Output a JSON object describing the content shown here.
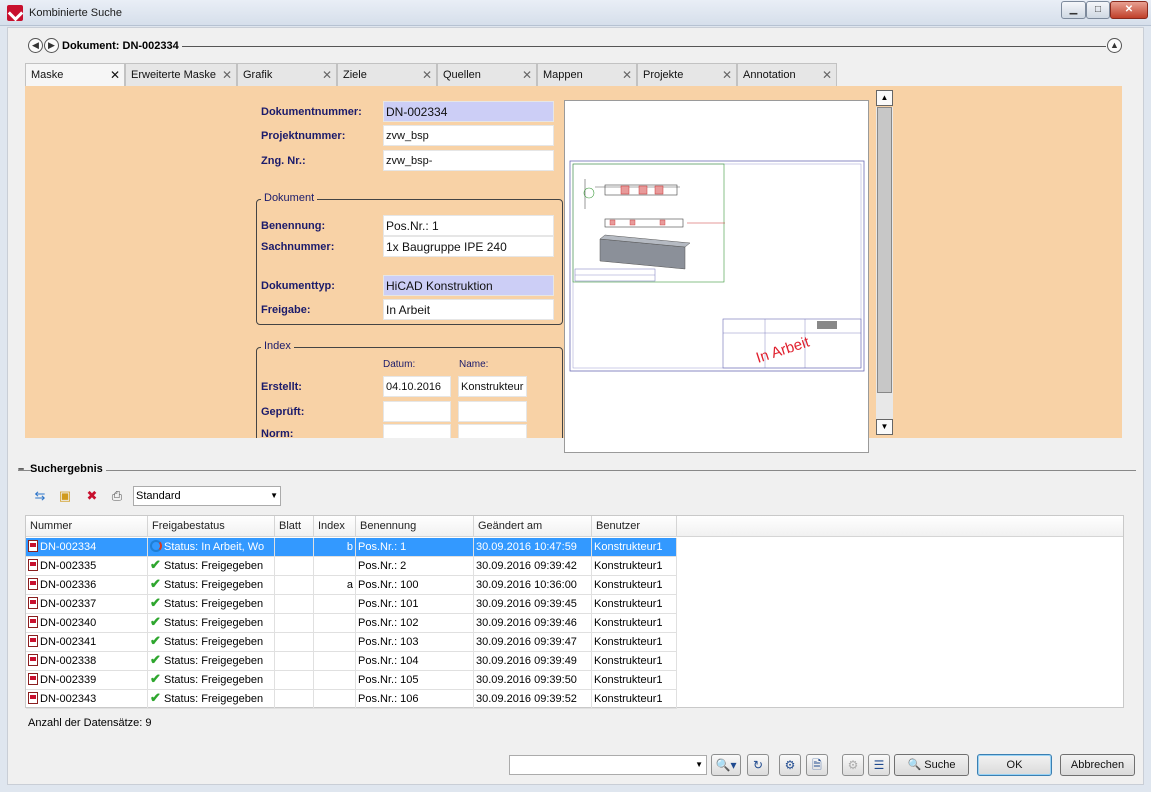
{
  "window": {
    "title": "Kombinierte Suche"
  },
  "header": {
    "title": "Dokument: DN-002334"
  },
  "tabs": [
    {
      "label": "Maske"
    },
    {
      "label": "Erweiterte Maske"
    },
    {
      "label": "Grafik"
    },
    {
      "label": "Ziele"
    },
    {
      "label": "Quellen"
    },
    {
      "label": "Mappen"
    },
    {
      "label": "Projekte"
    },
    {
      "label": "Annotation"
    }
  ],
  "form": {
    "dokumentnummer": {
      "label": "Dokumentnummer:",
      "value": "DN-002334"
    },
    "projektnummer": {
      "label": "Projektnummer:",
      "value": "zvw_bsp"
    },
    "zng_nr": {
      "label": "Zng. Nr.:",
      "value": "zvw_bsp-"
    },
    "dokument_group": "Dokument",
    "benennung": {
      "label": "Benennung:",
      "value": "Pos.Nr.: 1"
    },
    "sachnummer": {
      "label": "Sachnummer:",
      "value": "1x Baugruppe IPE 240"
    },
    "dokumenttyp": {
      "label": "Dokumenttyp:",
      "value": "HiCAD Konstruktion"
    },
    "freigabe": {
      "label": "Freigabe:",
      "value": "In Arbeit"
    },
    "index_group": "Index",
    "datum_header": "Datum:",
    "name_header": "Name:",
    "erstellt": {
      "label": "Erstellt:",
      "datum": "04.10.2016",
      "name": "Konstrukteur"
    },
    "geprueft": {
      "label": "Geprüft:"
    },
    "norm": {
      "label": "Norm:"
    }
  },
  "preview": {
    "stamp": "In Arbeit"
  },
  "results": {
    "title": "Suchergebnis",
    "view": "Standard",
    "columns": [
      "Nummer",
      "Freigabestatus",
      "Blatt",
      "Index",
      "Benennung",
      "Geändert am",
      "Benutzer"
    ],
    "rows": [
      {
        "nummer": "DN-002334",
        "status": "Status: In Arbeit, Wo",
        "blatt": "",
        "index": "b",
        "benennung": "Pos.Nr.: 1",
        "geaendert": "30.09.2016 10:47:59",
        "benutzer": "Konstrukteur1"
      },
      {
        "nummer": "DN-002335",
        "status": "Status: Freigegeben",
        "blatt": "",
        "index": "",
        "benennung": "Pos.Nr.: 2",
        "geaendert": "30.09.2016 09:39:42",
        "benutzer": "Konstrukteur1"
      },
      {
        "nummer": "DN-002336",
        "status": "Status: Freigegeben",
        "blatt": "",
        "index": "a",
        "benennung": "Pos.Nr.: 100",
        "geaendert": "30.09.2016 10:36:00",
        "benutzer": "Konstrukteur1"
      },
      {
        "nummer": "DN-002337",
        "status": "Status: Freigegeben",
        "blatt": "",
        "index": "",
        "benennung": "Pos.Nr.: 101",
        "geaendert": "30.09.2016 09:39:45",
        "benutzer": "Konstrukteur1"
      },
      {
        "nummer": "DN-002340",
        "status": "Status: Freigegeben",
        "blatt": "",
        "index": "",
        "benennung": "Pos.Nr.: 102",
        "geaendert": "30.09.2016 09:39:46",
        "benutzer": "Konstrukteur1"
      },
      {
        "nummer": "DN-002341",
        "status": "Status: Freigegeben",
        "blatt": "",
        "index": "",
        "benennung": "Pos.Nr.: 103",
        "geaendert": "30.09.2016 09:39:47",
        "benutzer": "Konstrukteur1"
      },
      {
        "nummer": "DN-002338",
        "status": "Status: Freigegeben",
        "blatt": "",
        "index": "",
        "benennung": "Pos.Nr.: 104",
        "geaendert": "30.09.2016 09:39:49",
        "benutzer": "Konstrukteur1"
      },
      {
        "nummer": "DN-002339",
        "status": "Status: Freigegeben",
        "blatt": "",
        "index": "",
        "benennung": "Pos.Nr.: 105",
        "geaendert": "30.09.2016 09:39:50",
        "benutzer": "Konstrukteur1"
      },
      {
        "nummer": "DN-002343",
        "status": "Status: Freigegeben",
        "blatt": "",
        "index": "",
        "benennung": "Pos.Nr.: 106",
        "geaendert": "30.09.2016 09:39:52",
        "benutzer": "Konstrukteur1"
      }
    ],
    "count": "Anzahl der Datensätze: 9"
  },
  "footer": {
    "suche_label": "Suche",
    "ok_label": "OK",
    "abbrechen_label": "Abbrechen"
  },
  "colors": {
    "form_bg": "#f8d2a6",
    "readonly_field": "#cccef6",
    "selection": "#3399ff",
    "label": "#1b1b6b"
  }
}
